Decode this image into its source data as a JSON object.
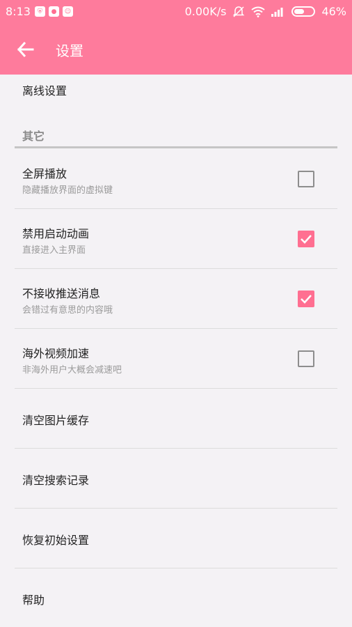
{
  "status": {
    "time": "8:13",
    "speed": "0.00K/s",
    "battery": "46%"
  },
  "appbar": {
    "title": "设置"
  },
  "content": {
    "offline_label": "离线设置",
    "section_header": "其它",
    "toggles": [
      {
        "title": "全屏播放",
        "subtitle": "隐藏播放界面的虚拟键",
        "checked": false
      },
      {
        "title": "禁用启动动画",
        "subtitle": "直接进入主界面",
        "checked": true
      },
      {
        "title": "不接收推送消息",
        "subtitle": "会错过有意思的内容哦",
        "checked": true
      },
      {
        "title": "海外视频加速",
        "subtitle": "非海外用户大概会减速吧",
        "checked": false
      }
    ],
    "actions": [
      {
        "title": "清空图片缓存"
      },
      {
        "title": "清空搜索记录"
      },
      {
        "title": "恢复初始设置"
      },
      {
        "title": "帮助"
      }
    ]
  },
  "colors": {
    "accent": "#fe7b9c",
    "checkbox_checked": "#ff6f91",
    "background": "#f4f2f5"
  }
}
